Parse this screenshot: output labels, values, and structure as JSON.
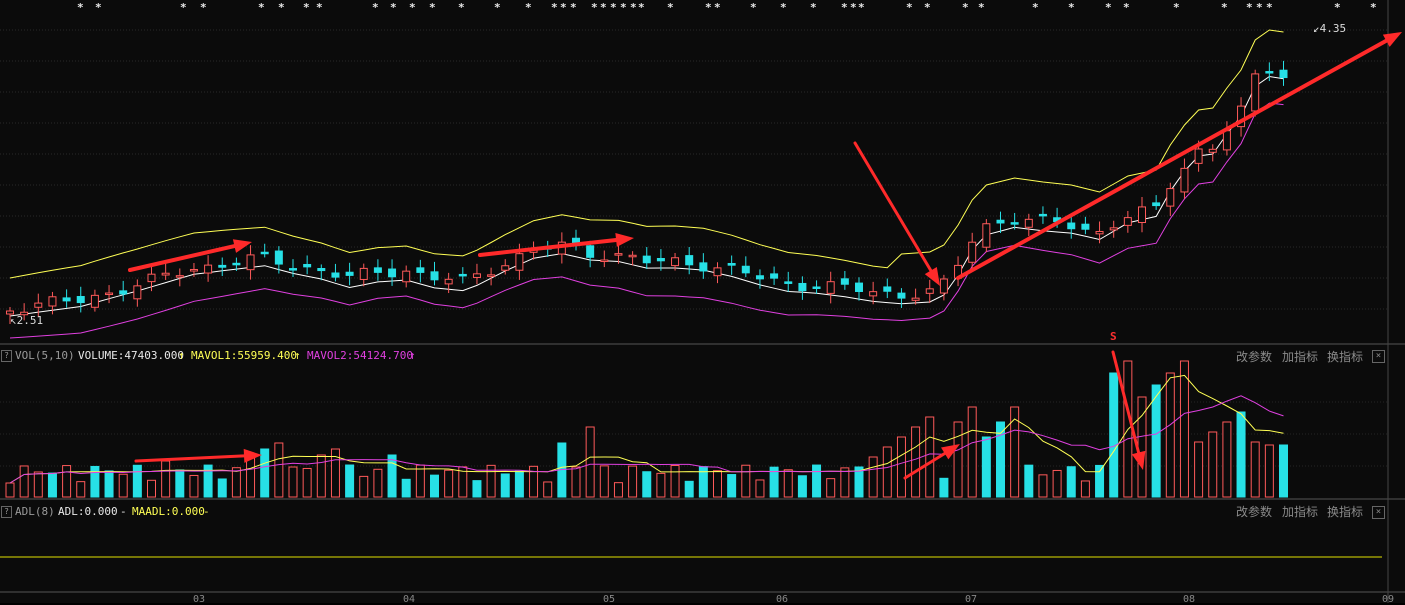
{
  "price_panel": {
    "high_marker": "4.35",
    "low_marker": "2.51",
    "s_marker": "S",
    "star_glyph": "*"
  },
  "vol_panel": {
    "help": "?",
    "name": "VOL(5,10)",
    "volume_text": "VOLUME:47403.000",
    "mavol1_text": "MAVOL1:55959.400",
    "mavol2_text": "MAVOL2:54124.700",
    "up_arrow": "↑",
    "btn_params": "改参数",
    "btn_add": "加指标",
    "btn_switch": "换指标",
    "close": "×"
  },
  "adl_panel": {
    "help": "?",
    "name": "ADL(8)",
    "adl_text": "ADL:0.000",
    "maadl_text": "MAADL:0.000",
    "dash": "-",
    "btn_params": "改参数",
    "btn_add": "加指标",
    "btn_switch": "换指标",
    "close": "×"
  },
  "x_axis": [
    "03",
    "04",
    "05",
    "06",
    "07",
    "08",
    "09"
  ],
  "colors": {
    "up": "#ff5a5a",
    "down": "#27e0e6",
    "mid": "#ffffff",
    "upper": "#ffff55",
    "lower": "#e040e0",
    "annotation": "#ff2a2a",
    "mavol1": "#ffff55",
    "mavol2": "#e040e0",
    "adl": "#e0e000"
  },
  "chart_data": {
    "type": "candlestick",
    "y_low_marker": 2.51,
    "y_high_marker": 4.35,
    "bar_count": 91,
    "vol_mavol1": 55959.4,
    "vol_mavol2": 54124.7,
    "vol_last": 47403.0,
    "adl": 0.0,
    "maadl": 0.0
  }
}
